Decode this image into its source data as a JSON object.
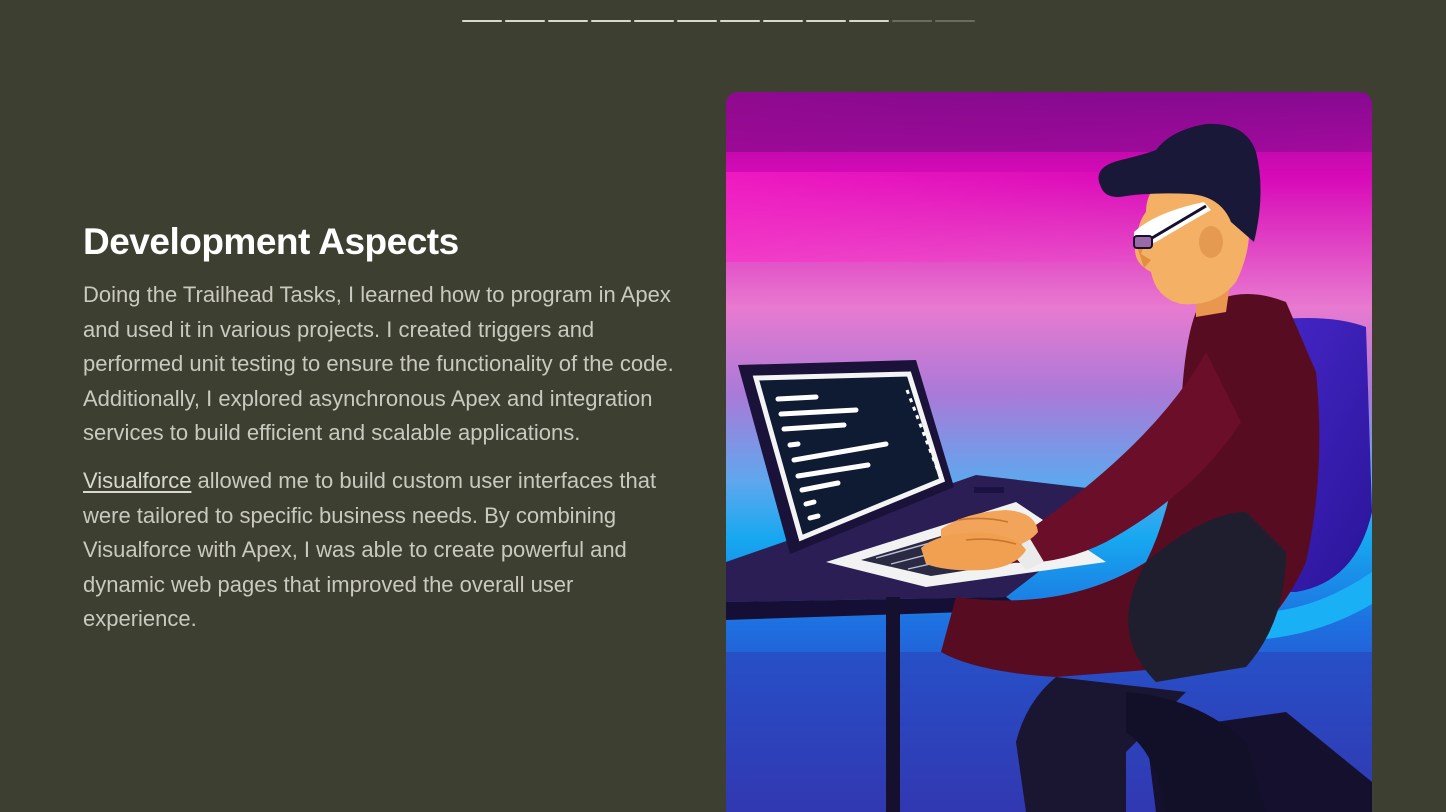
{
  "progress": {
    "total": 12,
    "active": 10
  },
  "section": {
    "title": "Development Aspects",
    "paragraph1": "Doing the Trailhead Tasks, I learned how to program in Apex and used it in various projects. I created triggers and performed unit testing to ensure the functionality of the code. Additionally, I explored asynchronous Apex and integration services to build efficient and scalable applications.",
    "paragraph2_link": "Visualforce",
    "paragraph2_rest": " allowed me to build custom user interfaces that were tailored to specific business needs. By combining Visualforce with Apex, I was able to create powerful and dynamic web pages that improved the overall user experience."
  },
  "colors": {
    "background": "#3d4030",
    "title": "#ffffff",
    "body_text": "#c9c9bf",
    "progress_active": "#d7d9cc",
    "progress_inactive": "#6a6d5c"
  },
  "illustration": {
    "icon": "developer-at-laptop-illustration"
  }
}
